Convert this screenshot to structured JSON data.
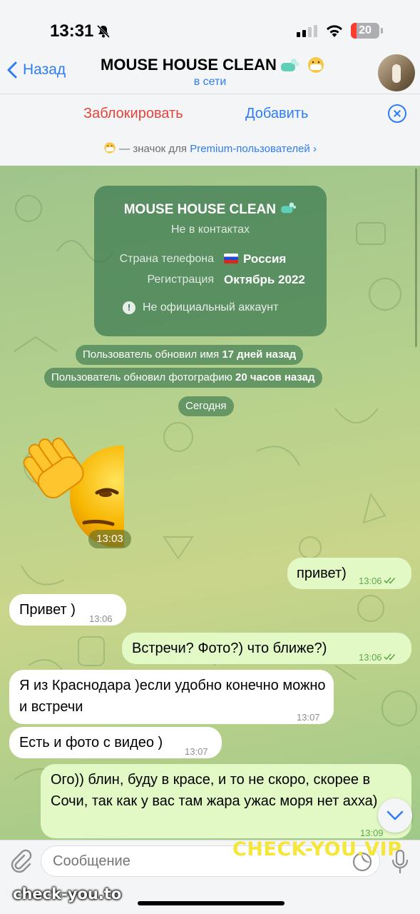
{
  "status_bar": {
    "time": "13:31",
    "battery": "20"
  },
  "header": {
    "back_label": "Назад",
    "title": "MOUSE HOUSE CLEAN",
    "status": "в сети"
  },
  "actions": {
    "block_label": "Заблокировать",
    "add_label": "Добавить"
  },
  "premium_note": {
    "text": " — значок для ",
    "link": "Premium-пользователей ›"
  },
  "info_card": {
    "title": "MOUSE HOUSE CLEAN",
    "subtitle": "Не в контактах",
    "country_label": "Страна телефона",
    "country_value": "Россия",
    "registration_label": "Регистрация",
    "registration_value": "Октябрь 2022",
    "note": "Не официальный аккаунт"
  },
  "service": {
    "name_update_prefix": "Пользователь обновил имя ",
    "name_update_time": "17 дней назад",
    "photo_update_prefix": "Пользователь обновил фотографию ",
    "photo_update_time": "20 часов назад",
    "date_separator": "Сегодня"
  },
  "sticker_time": "13:03",
  "messages": [
    {
      "dir": "out",
      "text": "привет)",
      "time": "13:06"
    },
    {
      "dir": "in",
      "text": "Привет )",
      "time": "13:06"
    },
    {
      "dir": "out",
      "text": "Встречи? Фото?) что ближе?)",
      "time": "13:06"
    },
    {
      "dir": "in",
      "text": "Я из Краснодара )если удобно конечно можно и встречи",
      "time": "13:07"
    },
    {
      "dir": "in",
      "text": "Есть и фото с видео )",
      "time": "13:07"
    },
    {
      "dir": "out",
      "text": "Ого)) блин, буду в красе, и то не скоро, скорее в Сочи, так как у вас там жара ужас моря нет ахха)",
      "time": "13:09"
    }
  ],
  "input": {
    "placeholder": "Сообщение"
  },
  "watermarks": {
    "yellow": "CHECK-YOU.VIP",
    "white": "check-you.to"
  },
  "colors": {
    "accent": "#2e7cf6",
    "danger": "#e5433b",
    "outgoing": "#e2f8c5",
    "card": "#3a7850"
  },
  "icons": [
    "chevron-left-icon",
    "bell-slash-icon",
    "wifi-icon",
    "close-icon",
    "warning-icon",
    "paperclip-icon",
    "moon-icon",
    "microphone-icon",
    "chevron-down-icon",
    "double-check-icon"
  ]
}
